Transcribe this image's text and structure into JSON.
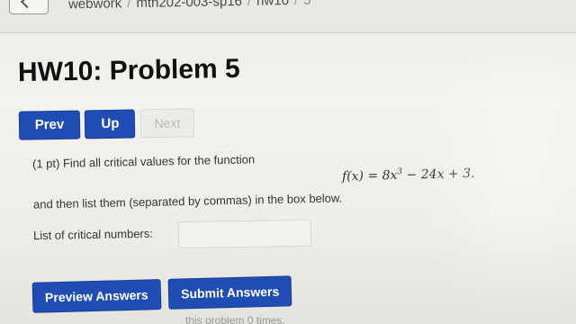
{
  "breadcrumb": {
    "items": [
      "webwork",
      "mth202-003-sp16",
      "hw10",
      "5"
    ]
  },
  "header": {
    "title": "HW10: Problem 5"
  },
  "nav": {
    "prev_label": "Prev",
    "up_label": "Up",
    "next_label": "Next"
  },
  "problem": {
    "prompt": "(1 pt) Find all critical values for the function",
    "formula": {
      "lhs": "f(x) = 8x",
      "exp": "3",
      "rhs": " − 24x + 3."
    },
    "instruction": "and then list them (separated by commas) in the box below.",
    "answer_label": "List of critical numbers:",
    "answer_value": ""
  },
  "actions": {
    "preview_label": "Preview Answers",
    "submit_label": "Submit Answers"
  },
  "footer": {
    "attempts_text": "this problem 0 times."
  },
  "colors": {
    "button_blue": "#1f4db3",
    "background": "#f3f2ee"
  }
}
